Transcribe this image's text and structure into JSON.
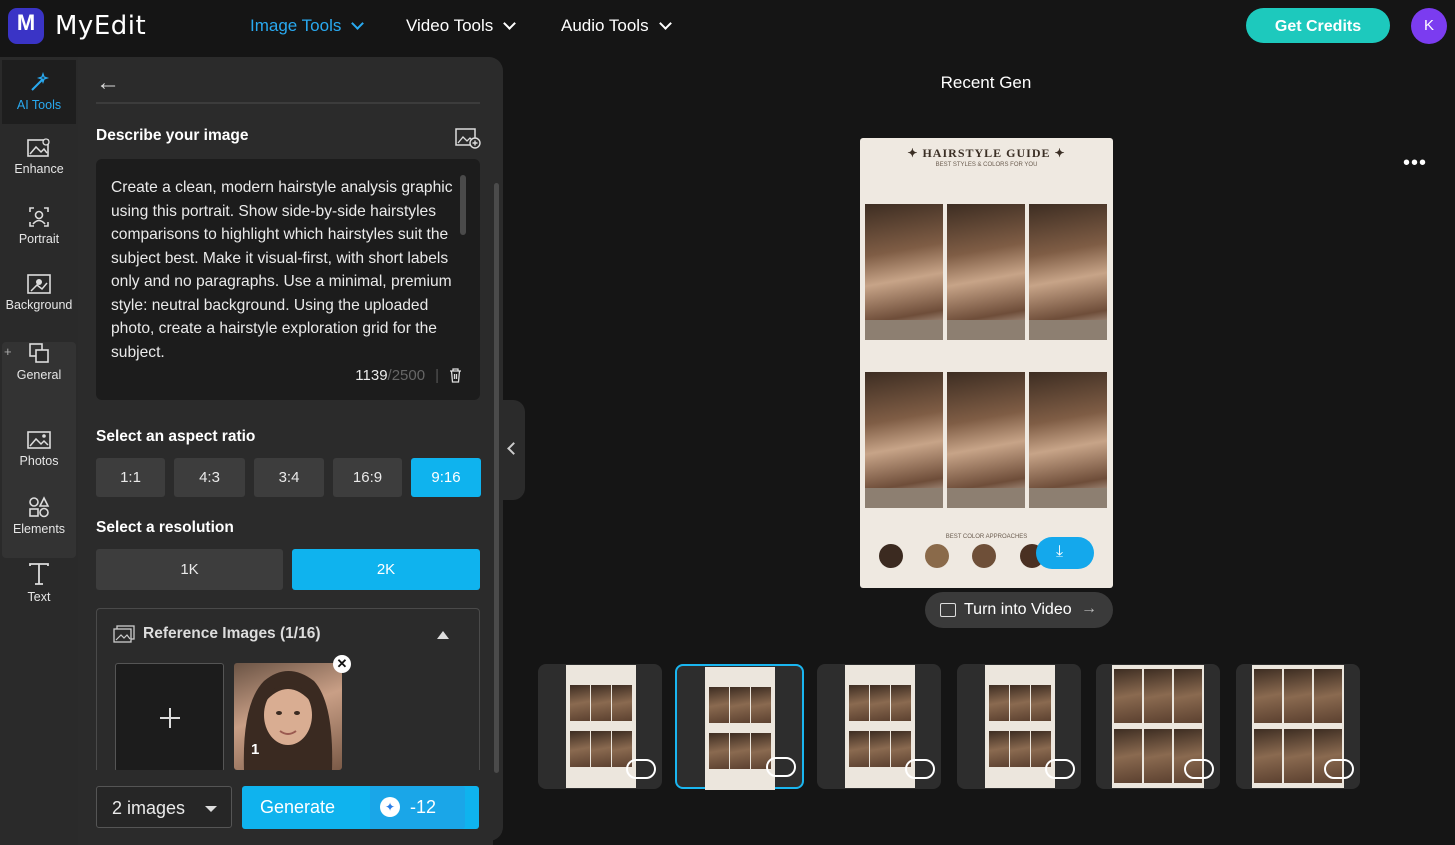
{
  "app": {
    "logo_letter": "M",
    "name": "MyEdit"
  },
  "nav": [
    {
      "label": "Image Tools",
      "active": true
    },
    {
      "label": "Video Tools",
      "active": false
    },
    {
      "label": "Audio Tools",
      "active": false
    }
  ],
  "header": {
    "credits_label": "Get Credits",
    "avatar_letter": "K"
  },
  "rail": {
    "items": [
      {
        "label": "AI Tools",
        "icon": "magic-wand-icon"
      },
      {
        "label": "Enhance",
        "icon": "enhance-icon"
      },
      {
        "label": "Portrait",
        "icon": "portrait-icon"
      },
      {
        "label": "Background",
        "icon": "background-icon"
      },
      {
        "label": "General",
        "icon": "general-icon"
      },
      {
        "label": "Photos",
        "icon": "photos-icon"
      },
      {
        "label": "Elements",
        "icon": "elements-icon"
      },
      {
        "label": "Text",
        "icon": "text-icon"
      }
    ],
    "plus": "+"
  },
  "panel": {
    "describe_title": "Describe your image",
    "prompt": "Create a clean, modern hairstyle analysis graphic using this portrait. Show side-by-side hairstyles comparisons to highlight which hairstyles suit the subject best. Make it visual-first, with short labels only and no paragraphs. Use a minimal, premium style: neutral background. Using the uploaded photo, create a hairstyle exploration grid for the subject.",
    "char_count": "1139",
    "char_max": "/2500",
    "char_sep": "|",
    "aspect_title": "Select an aspect ratio",
    "aspect_ratios": [
      "1:1",
      "4:3",
      "3:4",
      "16:9",
      "9:16"
    ],
    "aspect_selected": "9:16",
    "resolution_title": "Select a resolution",
    "resolutions": [
      "1K",
      "2K"
    ],
    "resolution_selected": "2K",
    "reference_title": "Reference Images (1/16)",
    "reference_index": "1",
    "image_count": "2 images",
    "generate_label": "Generate",
    "generate_cost": "-12"
  },
  "preview": {
    "recent_title": "Recent Gen",
    "more_label": "•••",
    "image_title": "✦ HAIRSTYLE GUIDE ✦",
    "image_subtitle": "BEST STYLES & COLORS FOR YOU",
    "image_colors_label": "BEST COLOR APPROACHES",
    "turn_video_label": "Turn into Video",
    "turn_video_arrow": "→"
  },
  "thumbnails": {
    "count": 6,
    "selected_index": 1
  }
}
